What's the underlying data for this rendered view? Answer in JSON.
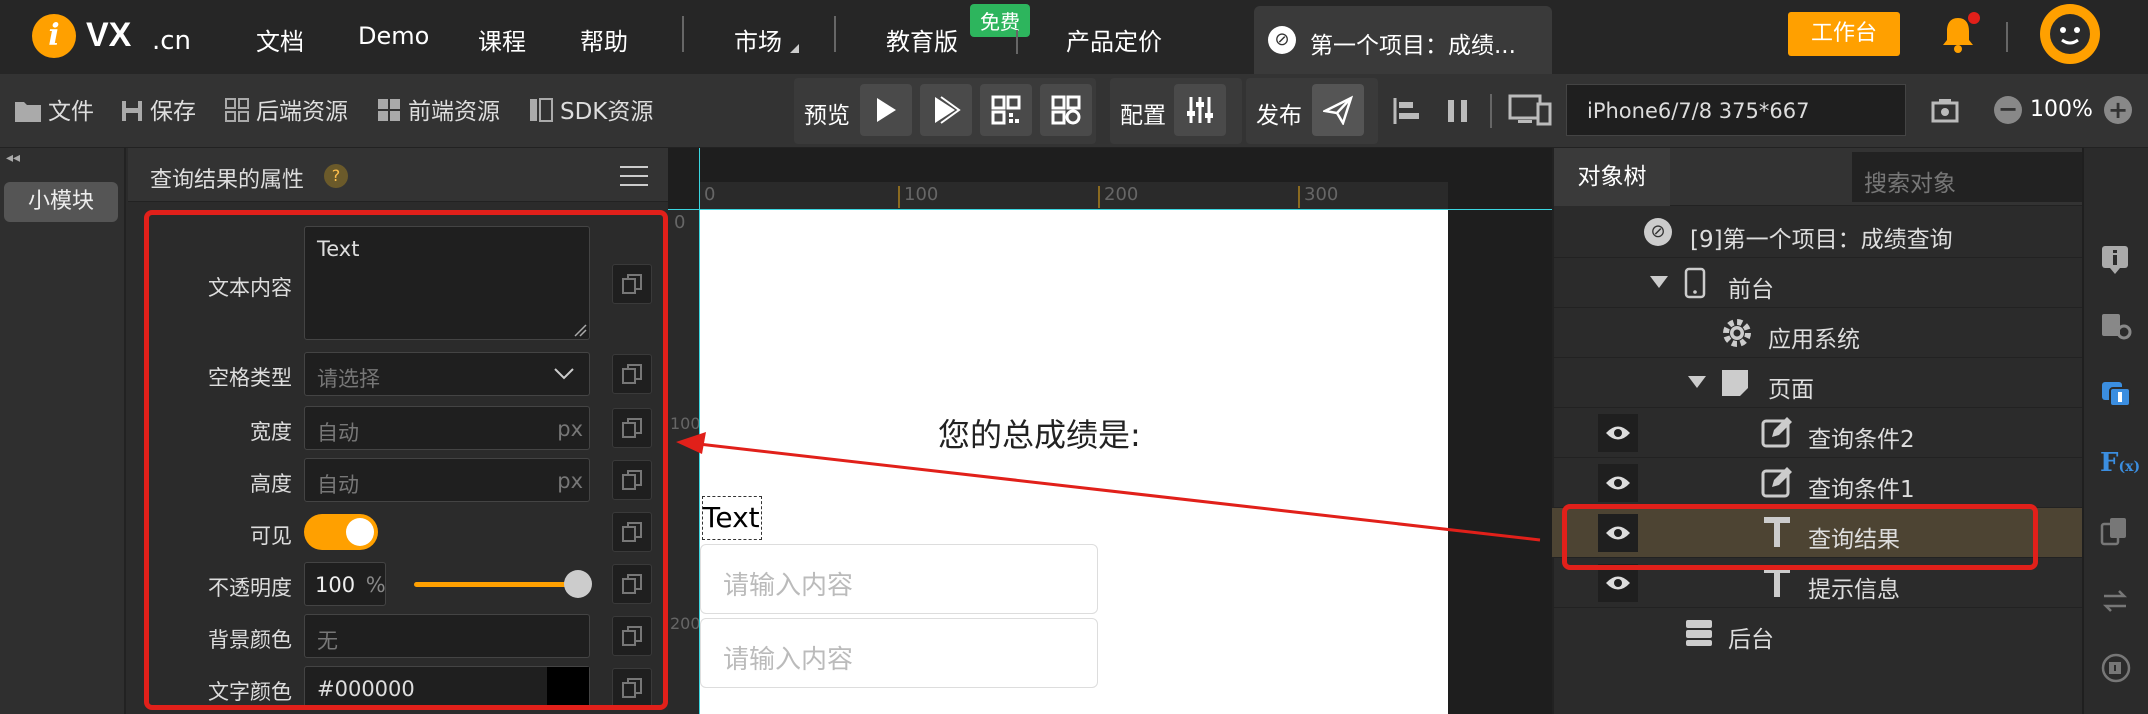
{
  "app": {
    "logo_text": "VX",
    "logo_domain": ".cn"
  },
  "topnav": {
    "items": [
      "文档",
      "Demo",
      "课程",
      "帮助",
      "市场",
      "教育版",
      "产品定价"
    ],
    "free_badge": "免费",
    "project_tab": "第一个项目：成绩...",
    "workbench": "工作台"
  },
  "toolbar": {
    "file": "文件",
    "save": "保存",
    "backend": "后端资源",
    "frontend": "前端资源",
    "sdk": "SDK资源",
    "preview": "预览",
    "config": "配置",
    "publish": "发布",
    "device": "iPhone6/7/8 375*667",
    "zoom": "100%"
  },
  "leftstrip": {
    "module": "小模块"
  },
  "properties": {
    "title": "查询结果的属性",
    "help": "?",
    "text_content_label": "文本内容",
    "text_content_value": "Text",
    "space_type_label": "空格类型",
    "space_type_placeholder": "请选择",
    "width_label": "宽度",
    "width_placeholder": "自动",
    "height_label": "高度",
    "height_placeholder": "自动",
    "unit": "px",
    "visible_label": "可见",
    "visible": true,
    "opacity_label": "不透明度",
    "opacity_value": "100",
    "opacity_unit": "%",
    "bg_color_label": "背景颜色",
    "bg_color_value": "无",
    "text_color_label": "文字颜色",
    "text_color_value": "#000000"
  },
  "canvas": {
    "ruler_h": [
      "0",
      "100",
      "200",
      "300"
    ],
    "ruler_v": [
      "0",
      "100",
      "200"
    ],
    "heading": "您的总成绩是:",
    "text_element": "Text",
    "input1_placeholder": "请输入内容",
    "input2_placeholder": "请输入内容"
  },
  "object_tree": {
    "tab": "对象树",
    "search_placeholder": "搜索对象",
    "project": "[9]第一个项目：成绩查询",
    "frontend": "前台",
    "app_system": "应用系统",
    "page": "页面",
    "cond2": "查询条件2",
    "cond1": "查询条件1",
    "result": "查询结果",
    "hint": "提示信息",
    "backend": "后台"
  },
  "colors": {
    "accent": "#ffa000",
    "highlight": "#e1201a",
    "selected_row": "#4d4433",
    "free_badge": "#2db55d"
  }
}
